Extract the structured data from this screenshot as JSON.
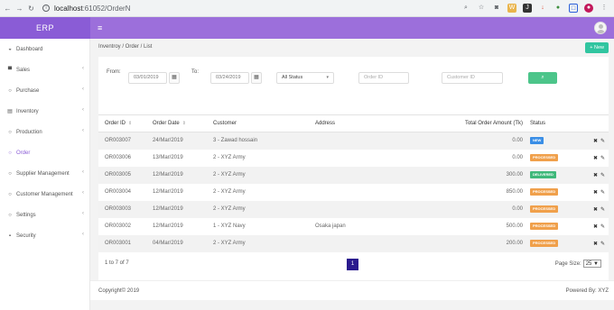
{
  "browser": {
    "url_host": "localhost",
    "url_path": ":61052/OrderN",
    "back_icon": "arrow-left-icon",
    "forward_icon": "arrow-right-icon",
    "reload_icon": "reload-icon"
  },
  "header": {
    "brand": "ERP",
    "menu_icon": "hamburger-icon"
  },
  "sidebar": {
    "items": [
      {
        "label": "Dashboard",
        "icon": "dashboard-icon"
      },
      {
        "label": "Sales",
        "icon": "cart-icon"
      },
      {
        "label": "Purchase",
        "icon": "circle-icon"
      },
      {
        "label": "Inventory",
        "icon": "inventory-icon"
      },
      {
        "label": "Production",
        "icon": "circle-icon"
      },
      {
        "label": "Order",
        "icon": "circle-icon"
      },
      {
        "label": "Supplier Management",
        "icon": "circle-icon"
      },
      {
        "label": "Customer Management",
        "icon": "circle-icon"
      },
      {
        "label": "Settings",
        "icon": "circle-icon"
      },
      {
        "label": "Security",
        "icon": "lock-icon"
      }
    ]
  },
  "breadcrumb": "Inventroy / Order / List",
  "new_button": "+ New",
  "filters": {
    "from_label": "From:",
    "from_value": "03/01/2019",
    "to_label": "To:",
    "to_value": "03/24/2019",
    "status_value": "All Status",
    "order_id_placeholder": "Order ID",
    "customer_id_placeholder": "Customer ID",
    "search_icon": "search-icon"
  },
  "table": {
    "headers": [
      "Order ID",
      "Order Date",
      "Customer",
      "Address",
      "Total Order Amount (Tk)",
      "Status"
    ],
    "rows": [
      {
        "order_id": "OR003007",
        "date": "24/Mar/2019",
        "customer": "3 - Zawad hossain",
        "address": "",
        "amount": "0.00",
        "status": "NEW"
      },
      {
        "order_id": "OR003006",
        "date": "13/Mar/2019",
        "customer": "2 - XYZ Army",
        "address": "",
        "amount": "0.00",
        "status": "PROCESSED"
      },
      {
        "order_id": "OR003005",
        "date": "12/Mar/2019",
        "customer": "2 - XYZ Army",
        "address": "",
        "amount": "300.00",
        "status": "DELIVERED"
      },
      {
        "order_id": "OR003004",
        "date": "12/Mar/2019",
        "customer": "2 - XYZ Army",
        "address": "",
        "amount": "850.00",
        "status": "PROCESSED"
      },
      {
        "order_id": "OR003003",
        "date": "12/Mar/2019",
        "customer": "2 - XYZ Army",
        "address": "",
        "amount": "0.00",
        "status": "PROCESSED"
      },
      {
        "order_id": "OR003002",
        "date": "12/Mar/2019",
        "customer": "1 - XYZ Navy",
        "address": "Osaka japan",
        "amount": "500.00",
        "status": "PROCESSED"
      },
      {
        "order_id": "OR003001",
        "date": "04/Mar/2019",
        "customer": "2 - XYZ Army",
        "address": "",
        "amount": "200.00",
        "status": "PROCESSED"
      }
    ],
    "status_colors": {
      "NEW": "#3a8ee6",
      "PROCESSED": "#f0a04b",
      "DELIVERED": "#3fb87a"
    }
  },
  "pagination": {
    "info": "1 to 7 of 7",
    "current_page": "1",
    "page_size_label": "Page Size:",
    "page_size": "25 ▼"
  },
  "footer": {
    "copyright": "Copyright© 2019",
    "powered": "Powered By: XYZ"
  },
  "colors": {
    "header": "#9c6fdb",
    "brand_bg": "#8a5cd6",
    "new_button": "#31c5a0",
    "search_button": "#4cc58a",
    "pager_active": "#2a1a8e"
  }
}
